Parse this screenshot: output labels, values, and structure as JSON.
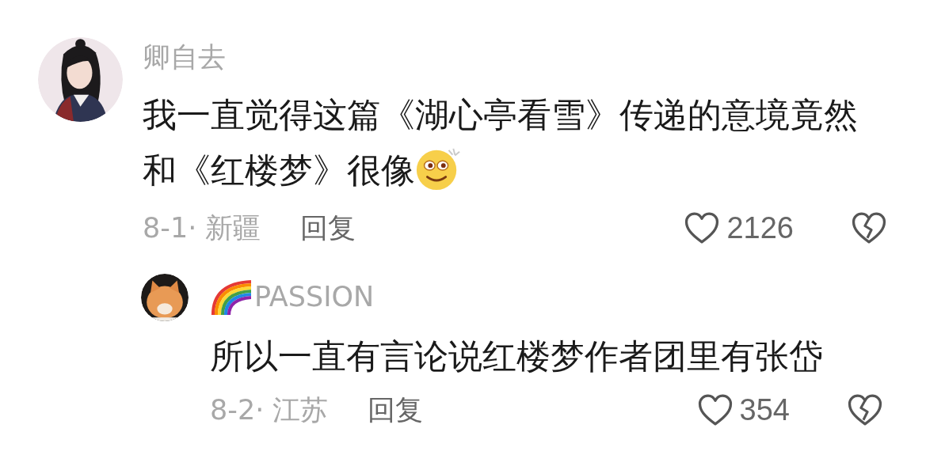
{
  "comments": [
    {
      "author": "卿自去",
      "badge": false,
      "text": "我一直觉得这篇《湖心亭看雪》传递的意境竟然和《红楼梦》很像",
      "emoji_end": true,
      "date_location": "8-1· 新疆",
      "reply_label": "回复",
      "likes": "2126",
      "replies": [
        {
          "author": "PASSION",
          "badge": true,
          "text": "所以一直有言论说红楼梦作者团里有张岱",
          "emoji_end": false,
          "date_location": "8-2· 江苏",
          "reply_label": "回复",
          "likes": "354"
        }
      ]
    }
  ]
}
